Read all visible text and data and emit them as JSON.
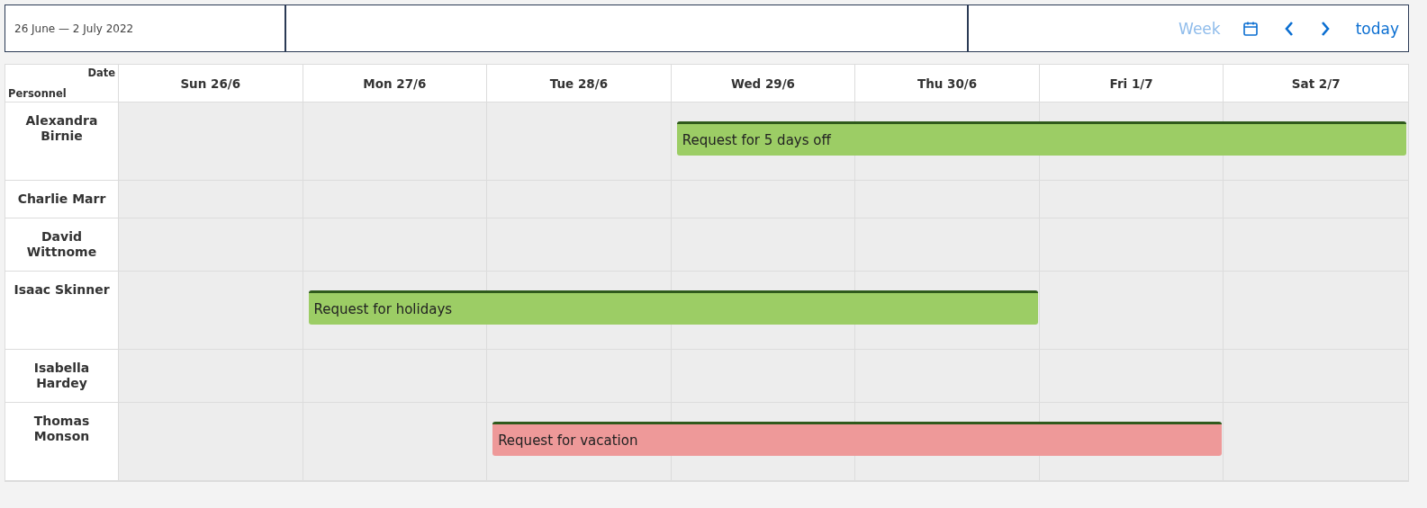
{
  "toolbar": {
    "date_range": "26 June — 2 July 2022",
    "view": {
      "label": "Week",
      "disabled": true
    },
    "today": "today"
  },
  "grid": {
    "corner": {
      "date": "Date",
      "personnel": "Personnel"
    },
    "days": [
      "Sun 26/6",
      "Mon 27/6",
      "Tue 28/6",
      "Wed 29/6",
      "Thu 30/6",
      "Fri 1/7",
      "Sat 2/7"
    ],
    "rows": [
      {
        "name": "Alexandra Birnie",
        "cells": [
          {
            "kind": "free"
          },
          {
            "kind": "free"
          },
          {
            "kind": "free"
          },
          {
            "kind": "event",
            "title": "Request for 5 days off",
            "color": "#9ccd65"
          },
          {
            "kind": "cont"
          },
          {
            "kind": "cont"
          },
          {
            "kind": "cont"
          }
        ]
      },
      {
        "name": "Charlie Marr",
        "cells": [
          {
            "kind": "free"
          },
          {
            "kind": "free"
          },
          {
            "kind": "free"
          },
          {
            "kind": "free"
          },
          {
            "kind": "free"
          },
          {
            "kind": "free"
          },
          {
            "kind": "free"
          }
        ]
      },
      {
        "name": "David Wittnome",
        "cells": [
          {
            "kind": "free"
          },
          {
            "kind": "free"
          },
          {
            "kind": "free"
          },
          {
            "kind": "free"
          },
          {
            "kind": "free"
          },
          {
            "kind": "free"
          },
          {
            "kind": "free"
          }
        ]
      },
      {
        "name": "Isaac Skinner",
        "cells": [
          {
            "kind": "free"
          },
          {
            "kind": "event",
            "title": "Request for holidays",
            "color": "#9ccd65"
          },
          {
            "kind": "cont"
          },
          {
            "kind": "cont"
          },
          {
            "kind": "cont"
          },
          {
            "kind": "free"
          },
          {
            "kind": "free"
          }
        ]
      },
      {
        "name": "Isabella Hardey",
        "cells": [
          {
            "kind": "free"
          },
          {
            "kind": "free"
          },
          {
            "kind": "free"
          },
          {
            "kind": "free"
          },
          {
            "kind": "free"
          },
          {
            "kind": "free"
          },
          {
            "kind": "free"
          }
        ]
      },
      {
        "name": "Thomas Monson",
        "cells": [
          {
            "kind": "free"
          },
          {
            "kind": "free"
          },
          {
            "kind": "event",
            "title": "Request for vacation",
            "color": "#ee9999"
          },
          {
            "kind": "cont"
          },
          {
            "kind": "cont"
          },
          {
            "kind": "cont"
          },
          {
            "kind": "free"
          }
        ]
      }
    ]
  }
}
